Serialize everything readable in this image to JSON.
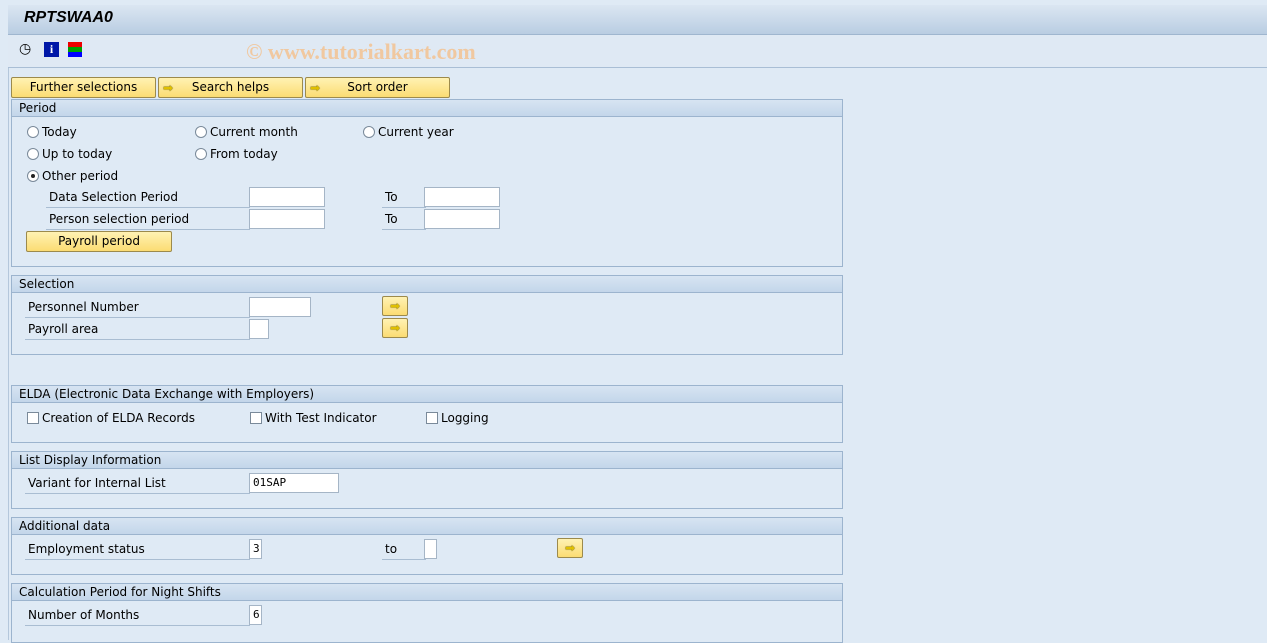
{
  "title": "RPTSWAA0",
  "watermark": "© www.tutorialkart.com",
  "toolbar": {
    "icons": [
      "execute-clock-icon",
      "info-icon",
      "selection-screen-icon"
    ]
  },
  "tabs": {
    "further": "Further selections",
    "search": "Search helps",
    "sort": "Sort order"
  },
  "period": {
    "header": "Period",
    "today": "Today",
    "current_month": "Current month",
    "current_year": "Current year",
    "up_to_today": "Up to today",
    "from_today": "From today",
    "other_period": "Other period",
    "selected": "Other period",
    "data_sel": "Data Selection Period",
    "person_sel": "Person selection period",
    "to": "To",
    "data_from": "",
    "data_to": "",
    "person_from": "",
    "person_to": "",
    "payroll_button": "Payroll period"
  },
  "selection": {
    "header": "Selection",
    "pernr": "Personnel Number",
    "pernr_value": "",
    "payroll_area": "Payroll area",
    "payroll_area_value": ""
  },
  "elda": {
    "header": "ELDA (Electronic Data Exchange with Employers)",
    "creation": "Creation of ELDA Records",
    "test": "With Test Indicator",
    "logging": "Logging"
  },
  "list": {
    "header": "List Display Information",
    "variant": "Variant for Internal List",
    "variant_value": "01SAP"
  },
  "additional": {
    "header": "Additional data",
    "emp_status": "Employment status",
    "emp_from": "3",
    "to": "to",
    "emp_to": ""
  },
  "night": {
    "header": "Calculation Period for Night Shifts",
    "months": "Number of Months",
    "months_value": "6"
  }
}
